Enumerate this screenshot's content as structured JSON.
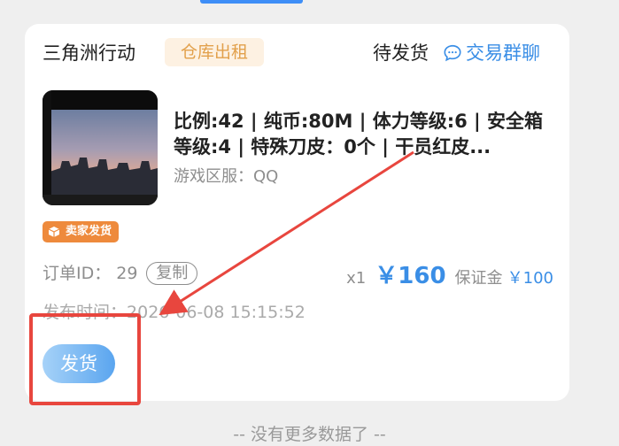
{
  "order": {
    "game_name": "三角洲行动",
    "type_tag": "仓库出租",
    "status": "待发货",
    "chat_label": "交易群聊",
    "title": "比例:42 | 纯币:80M | 体力等级:6 | 安全箱等级:4 | 特殊刀皮：0个 | 干员红皮...",
    "server_label": "游戏区服：",
    "server_value": "QQ",
    "seller_badge": "卖家发货",
    "order_id_label": "订单ID：",
    "order_id": "29",
    "copy_label": "复制",
    "quantity": "x1",
    "price": "￥160",
    "deposit_label": "保证金",
    "deposit_value": "￥100",
    "publish_label": "发布时间：",
    "publish_time": "2026-06-08 15:15:52",
    "ship_button": "发货"
  },
  "footer": {
    "no_more": "-- 没有更多数据了 --"
  },
  "colors": {
    "accent": "#3a8ee6",
    "tag_bg": "#fdf1e2",
    "tag_text": "#e2a04b",
    "seller_badge": "#ee8a3c",
    "annotation": "#e8463e"
  },
  "icons": {
    "chat": "chat-bubble-icon",
    "seller": "box-icon"
  }
}
